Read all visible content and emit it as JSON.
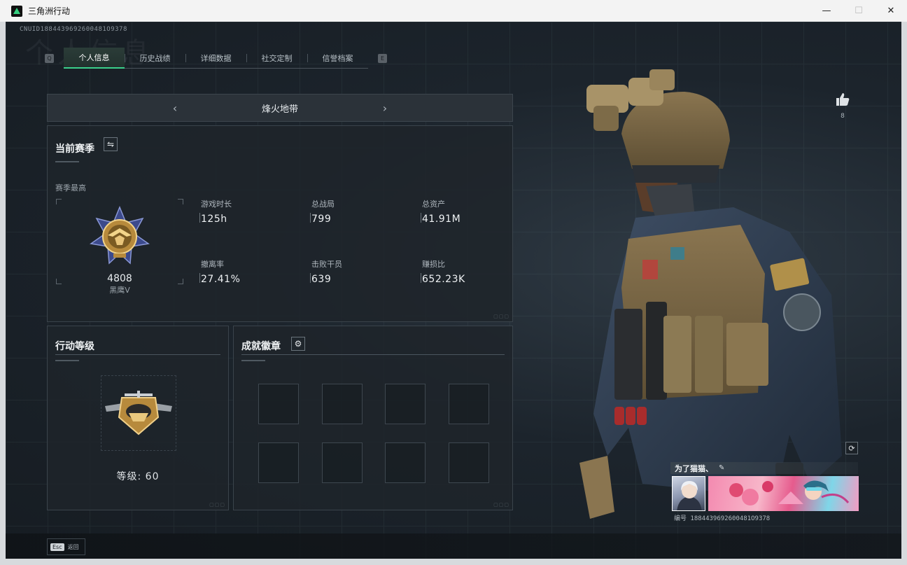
{
  "window": {
    "title": "三角洲行动",
    "minimize": "—",
    "maximize": "☐",
    "close": "✕"
  },
  "header": {
    "cnuid": "CNUID1884439692600481O9378",
    "ghost_title": "个人信息"
  },
  "tabs": {
    "left_key": "Q",
    "right_key": "E",
    "items": [
      {
        "label": "个人信息",
        "active": true
      },
      {
        "label": "历史战绩",
        "active": false
      },
      {
        "label": "详细数据",
        "active": false
      },
      {
        "label": "社交定制",
        "active": false
      },
      {
        "label": "信誉档案",
        "active": false
      }
    ]
  },
  "mode_selector": {
    "prev": "‹",
    "title": "烽火地带",
    "next": "›"
  },
  "season": {
    "title": "当前赛季",
    "subtitle": "赛季最高",
    "rank_score": "4808",
    "rank_name": "黑鹰V",
    "stats": [
      {
        "label": "游戏时长",
        "value": "125h"
      },
      {
        "label": "总战局",
        "value": "799"
      },
      {
        "label": "总资产",
        "value": "41.91M"
      },
      {
        "label": "撤离率",
        "value": "27.41%"
      },
      {
        "label": "击败干员",
        "value": "639"
      },
      {
        "label": "赚损比",
        "value": "652.23K"
      }
    ]
  },
  "level": {
    "title": "行动等级",
    "text": "等级: 60"
  },
  "badges": {
    "title": "成就徽章",
    "slot_count": 8
  },
  "profile": {
    "likes": "8",
    "player_name": "为了猫猫、",
    "card_id": "编号 1884439692600481O9378"
  },
  "footer": {
    "esc_key": "Esc",
    "back_label": "返回"
  },
  "colors": {
    "accent": "#3ad08c",
    "background": "#1c242c",
    "panel": "#1e242a"
  }
}
